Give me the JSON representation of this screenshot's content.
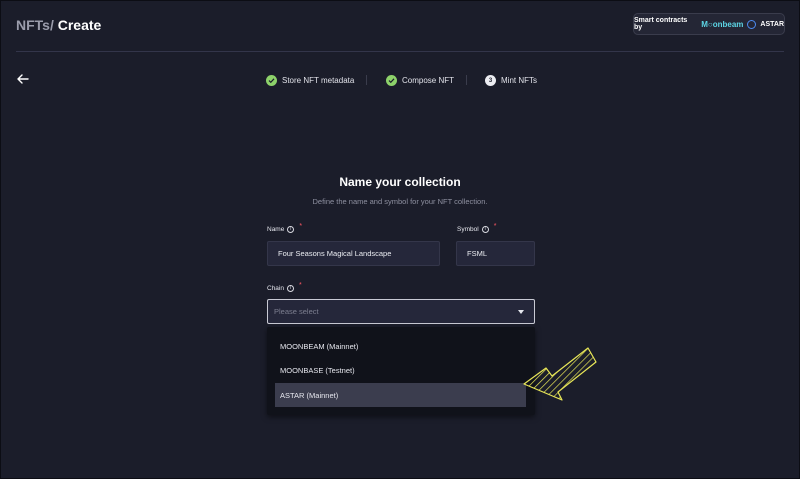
{
  "header": {
    "breadcrumb_parent": "NFTs/",
    "breadcrumb_current": "Create",
    "powered_prefix": "Smart contracts by",
    "powered_moonbeam": "M○onbeam",
    "powered_astar": "ASTAR"
  },
  "stepper": {
    "steps": [
      {
        "label": "Store NFT metadata",
        "state": "done",
        "icon": "check-icon"
      },
      {
        "label": "Compose NFT",
        "state": "done",
        "icon": "check-icon"
      },
      {
        "label": "Mint NFTs",
        "state": "current",
        "number": "3"
      }
    ]
  },
  "form": {
    "title": "Name your collection",
    "subtitle": "Define the name and symbol for your NFT collection.",
    "name_label": "Name",
    "name_value": "Four Seasons Magical Landscape",
    "symbol_label": "Symbol",
    "symbol_value": "FSML",
    "chain_label": "Chain",
    "chain_placeholder": "Please select",
    "required_mark": "*",
    "info_glyph": "i"
  },
  "dropdown": {
    "options": [
      "MOONBEAM (Mainnet)",
      "MOONBASE (Testnet)",
      "ASTAR (Mainnet)"
    ],
    "highlighted": "ASTAR (Mainnet)"
  },
  "colors": {
    "background": "#1b1d2a",
    "step_done": "#8dd26a",
    "required": "#ff5864",
    "annotation_arrow": "#e8e657"
  }
}
